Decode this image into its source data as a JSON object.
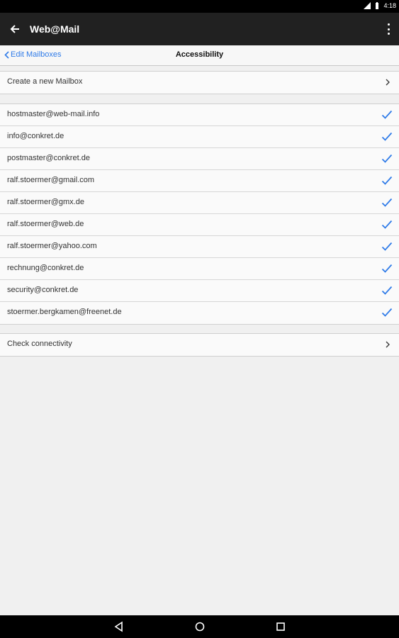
{
  "status_bar": {
    "time": "4:18"
  },
  "app_bar": {
    "title": "Web@Mail"
  },
  "nav_bar": {
    "back_label": "Edit Mailboxes",
    "title": "Accessibility"
  },
  "create_section": {
    "label": "Create a new Mailbox"
  },
  "mailboxes": [
    "hostmaster@web-mail.info",
    "info@conkret.de",
    "postmaster@conkret.de",
    "ralf.stoermer@gmail.com",
    "ralf.stoermer@gmx.de",
    "ralf.stoermer@web.de",
    "ralf.stoermer@yahoo.com",
    "rechnung@conkret.de",
    "security@conkret.de",
    "stoermer.bergkamen@freenet.de"
  ],
  "connectivity_section": {
    "label": "Check connectivity"
  },
  "colors": {
    "accent": "#2f7be8",
    "app_bar": "#212121",
    "background": "#f0f0f0"
  }
}
